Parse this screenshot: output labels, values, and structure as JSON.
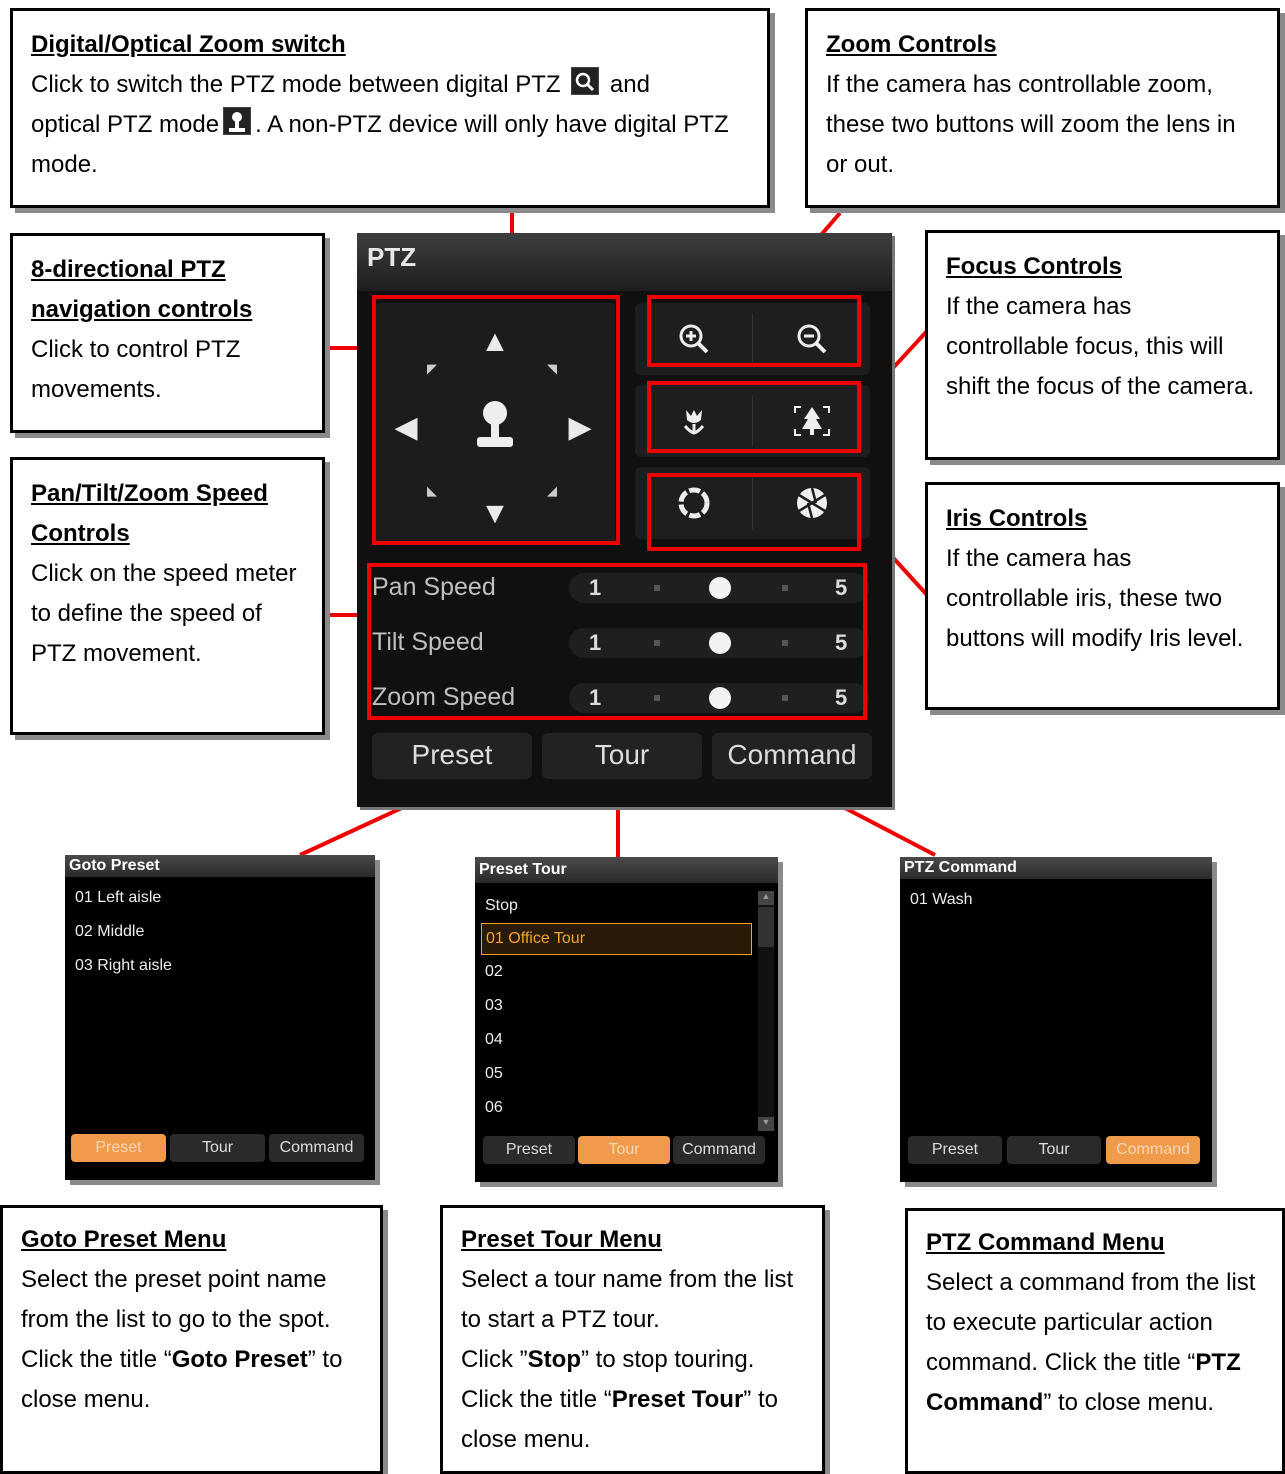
{
  "callouts": {
    "digital_zoom": {
      "title": "Digital/Optical Zoom switch",
      "line1": "Click to switch the PTZ mode between digital PTZ",
      "line2": "and",
      "line3": "optical PTZ mode",
      "line4": ". A non-PTZ device will only have digital PTZ mode."
    },
    "zoom": {
      "title": "Zoom Controls",
      "body": "If the camera has controllable zoom, these two buttons will zoom the lens in or out."
    },
    "nav": {
      "title": "8-directional PTZ navigation controls",
      "body": "Click to control PTZ movements."
    },
    "focus": {
      "title": "Focus Controls",
      "body": "If the camera has controllable focus, this will shift the focus of the camera."
    },
    "speed": {
      "title": "Pan/Tilt/Zoom Speed Controls",
      "body": "Click on the speed meter to define the speed of PTZ movement."
    },
    "iris": {
      "title": "Iris Controls",
      "body": "If the camera has controllable iris, these two buttons will modify Iris level."
    },
    "goto_preset": {
      "title": "Goto Preset Menu",
      "body1": "Select the preset point name from the list to go to the spot. Click the title “",
      "bold": "Goto Preset",
      "body2": "” to close menu."
    },
    "preset_tour": {
      "title": "Preset Tour Menu",
      "body1": "Select a tour name from the list to start a PTZ tour.",
      "body2": "Click ”",
      "bold1": "Stop",
      "body3": "” to stop touring. Click the title “",
      "bold2": "Preset Tour",
      "body4": "” to close menu."
    },
    "ptz_command": {
      "title": "PTZ Command Menu",
      "body1": "Select a command from the list to execute particular action command. Click the title “",
      "bold": "PTZ Command",
      "body2": "” to close menu."
    }
  },
  "ptz": {
    "title": "PTZ",
    "speeds": [
      {
        "label": "Pan Speed",
        "min": "1",
        "max": "5",
        "value": 3
      },
      {
        "label": "Tilt Speed",
        "min": "1",
        "max": "5",
        "value": 3
      },
      {
        "label": "Zoom Speed",
        "min": "1",
        "max": "5",
        "value": 3
      }
    ],
    "tabs": [
      "Preset",
      "Tour",
      "Command"
    ]
  },
  "menus": {
    "goto_preset": {
      "title": "Goto Preset",
      "items": [
        "01 Left aisle",
        "02 Middle",
        "03 Right aisle"
      ],
      "tabs": [
        "Preset",
        "Tour",
        "Command"
      ],
      "active": 0
    },
    "preset_tour": {
      "title": "Preset Tour",
      "items": [
        "Stop",
        "01 Office Tour",
        "02",
        "03",
        "04",
        "05",
        "06"
      ],
      "selected": 1,
      "tabs": [
        "Preset",
        "Tour",
        "Command"
      ],
      "active": 1
    },
    "ptz_command": {
      "title": "PTZ Command",
      "items": [
        "01 Wash"
      ],
      "tabs": [
        "Preset",
        "Tour",
        "Command"
      ],
      "active": 2
    }
  },
  "colors": {
    "highlight": "#ee0000",
    "active_tab": "#f09a4c",
    "selected_item": "#f5a623"
  }
}
